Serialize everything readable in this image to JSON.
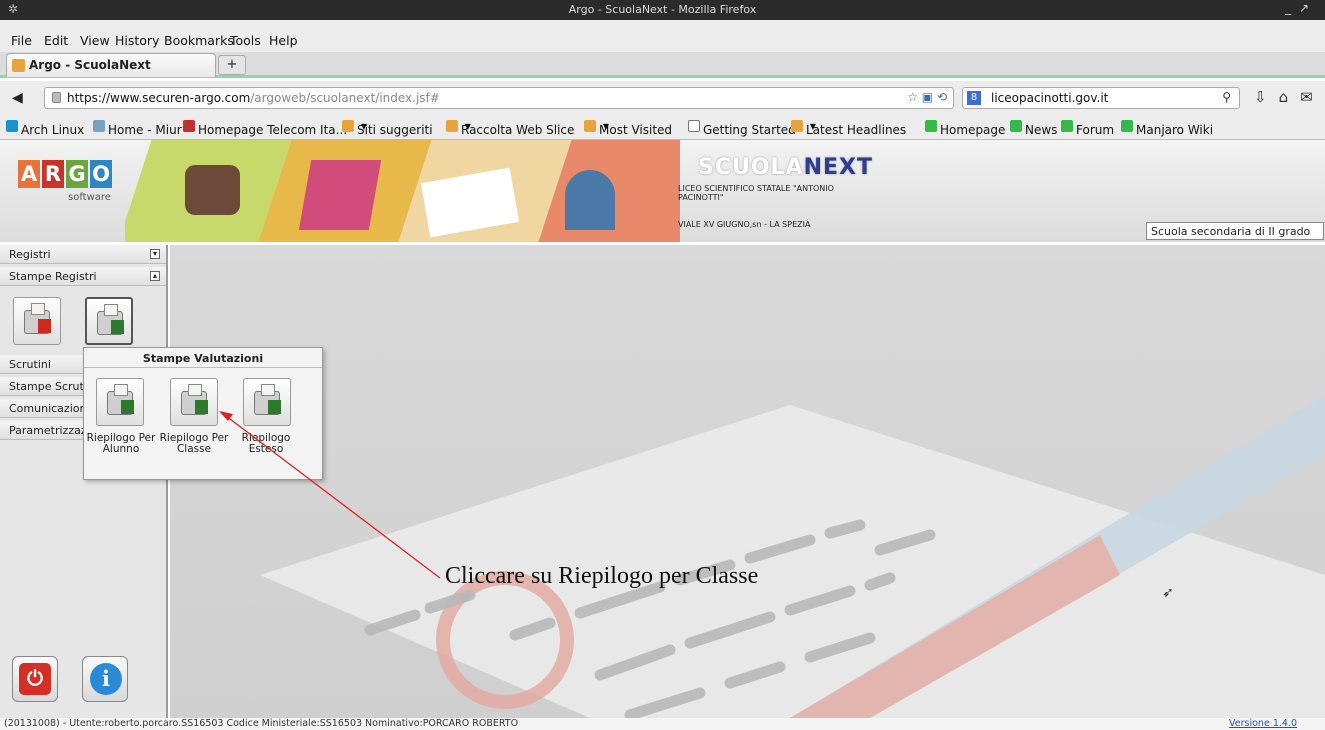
{
  "window": {
    "title": "Argo - ScuolaNext - Mozilla Firefox"
  },
  "menu": [
    "File",
    "Edit",
    "View",
    "History",
    "Bookmarks",
    "Tools",
    "Help"
  ],
  "tab": {
    "label": "Argo - ScuolaNext",
    "newtab": "+"
  },
  "nav": {
    "url_host": "https://www.securen-argo.com",
    "url_path": "/argoweb/scuolanext/index.jsf#",
    "search_value": "liceopacinotti.gov.it",
    "search_engine_icon": "8"
  },
  "bookmarks": [
    "Arch Linux",
    "Home - Miur",
    "Homepage Telecom Ita...",
    "Siti suggeriti",
    "Raccolta Web Slice",
    "Most Visited",
    "Getting Started",
    "Latest Headlines",
    "Homepage",
    "News",
    "Forum",
    "Manjaro Wiki"
  ],
  "banner": {
    "logo_letters": [
      "A",
      "R",
      "G",
      "O"
    ],
    "logo_sub": "software",
    "product_a": "SCUOLA",
    "product_b": "NEXT",
    "school_name": "LICEO SCIENTIFICO STATALE \"ANTONIO PACINOTTI\"",
    "school_address": "VIALE XV GIUGNO,sn - LA SPEZIA",
    "grade_select": "Scuola secondaria di II grado"
  },
  "sidebar": {
    "sections": [
      "Registri",
      "Stampe Registri",
      "Scrutini",
      "Stampe Scruti",
      "Comunicazioni",
      "Parametrizzazi"
    ],
    "toggle_open": "▾",
    "toggle_closed": "▴"
  },
  "popup": {
    "title": "Stampe Valutazioni",
    "items": [
      "Riepilogo Per Alunno",
      "Riepilogo Per Classe",
      "Riepilogo Esteso"
    ]
  },
  "annotation": "Cliccare su Riepilogo per Classe",
  "status": {
    "left": "(20131008) - Utente:roberto.porcaro.SS16503 Codice Ministeriale:SS16503 Nominativo:PORCARO ROBERTO",
    "right": "Versione 1.4.0"
  },
  "colors": {
    "annotation_arrow": "#e02020",
    "tab_accent": "#8fd6a8",
    "logo": [
      "#e8733a",
      "#c9342a",
      "#6aa63f",
      "#2f86c4"
    ]
  }
}
